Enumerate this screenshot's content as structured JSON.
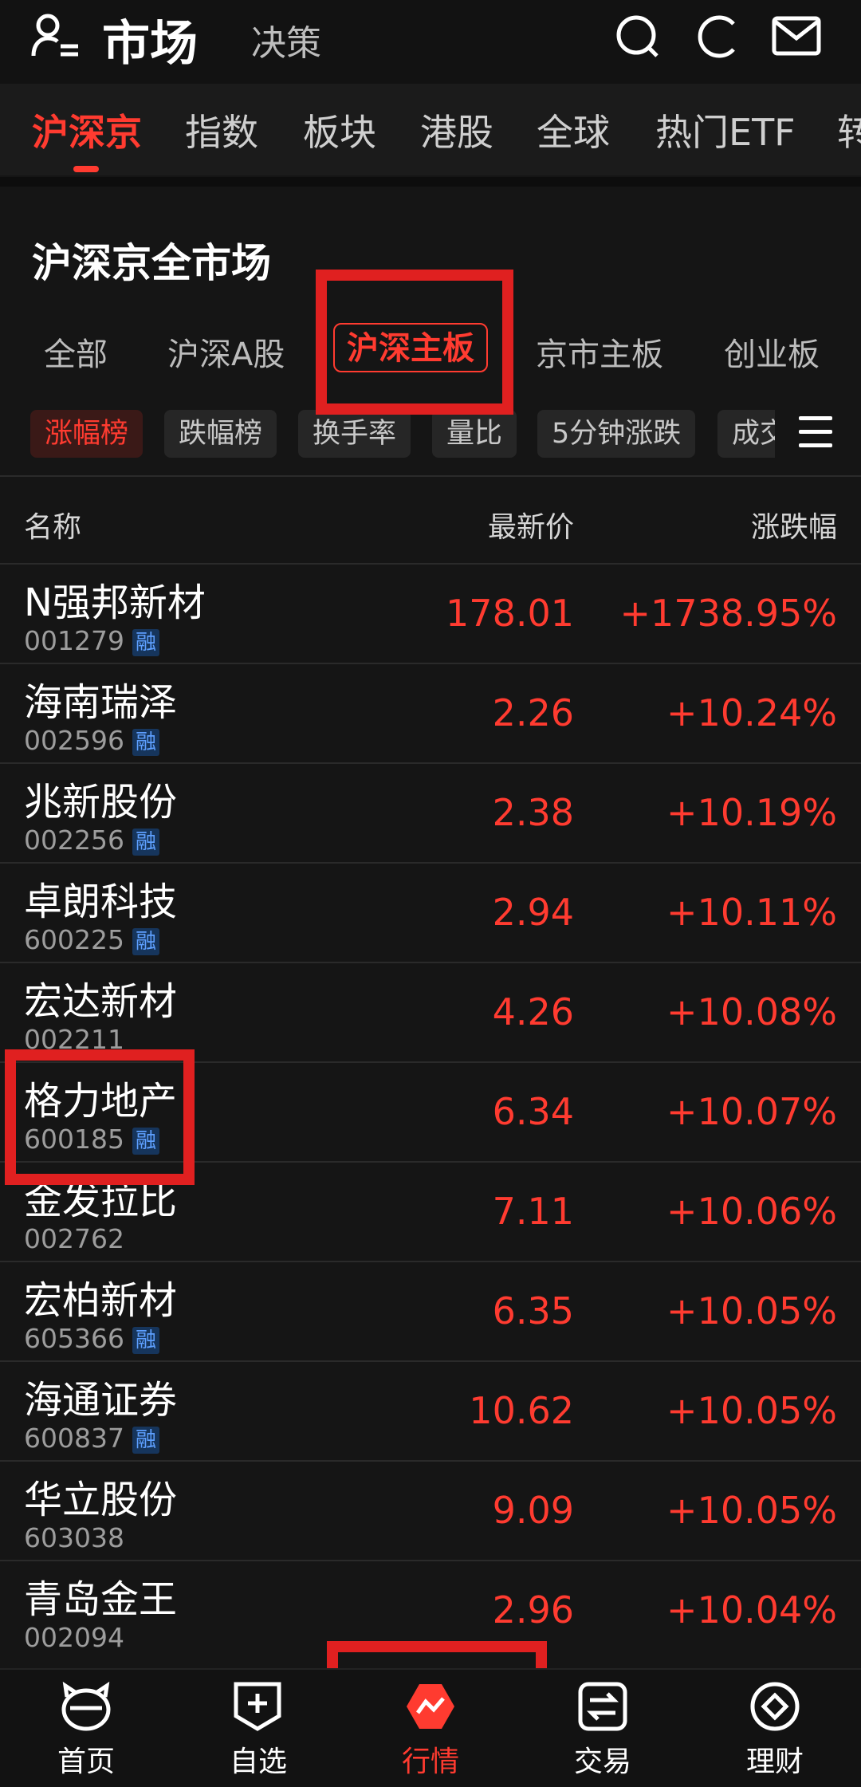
{
  "header": {
    "title": "市场",
    "subtitle": "决策"
  },
  "market_tabs": [
    "沪深京",
    "指数",
    "板块",
    "港股",
    "全球",
    "热门ETF",
    "转"
  ],
  "section_title": "沪深京全市场",
  "board_tabs": [
    "全部",
    "沪深A股",
    "沪深主板",
    "京市主板",
    "创业板"
  ],
  "chips": [
    "涨幅榜",
    "跌幅榜",
    "换手率",
    "量比",
    "5分钟涨跌",
    "成交"
  ],
  "columns": {
    "name": "名称",
    "price": "最新价",
    "change": "涨跌幅"
  },
  "rong_label": "融",
  "stocks": [
    {
      "name": "N强邦新材",
      "code": "001279",
      "price": "178.01",
      "change": "+1738.95%",
      "rong": true
    },
    {
      "name": "海南瑞泽",
      "code": "002596",
      "price": "2.26",
      "change": "+10.24%",
      "rong": true
    },
    {
      "name": "兆新股份",
      "code": "002256",
      "price": "2.38",
      "change": "+10.19%",
      "rong": true
    },
    {
      "name": "卓朗科技",
      "code": "600225",
      "price": "2.94",
      "change": "+10.11%",
      "rong": true
    },
    {
      "name": "宏达新材",
      "code": "002211",
      "price": "4.26",
      "change": "+10.08%",
      "rong": false
    },
    {
      "name": "格力地产",
      "code": "600185",
      "price": "6.34",
      "change": "+10.07%",
      "rong": true
    },
    {
      "name": "金发拉比",
      "code": "002762",
      "price": "7.11",
      "change": "+10.06%",
      "rong": false
    },
    {
      "name": "宏柏新材",
      "code": "605366",
      "price": "6.35",
      "change": "+10.05%",
      "rong": true
    },
    {
      "name": "海通证券",
      "code": "600837",
      "price": "10.62",
      "change": "+10.05%",
      "rong": true
    },
    {
      "name": "华立股份",
      "code": "603038",
      "price": "9.09",
      "change": "+10.05%",
      "rong": false
    },
    {
      "name": "青岛金王",
      "code": "002094",
      "price": "2.96",
      "change": "+10.04%",
      "rong": false
    }
  ],
  "bottom_nav": [
    "首页",
    "自选",
    "行情",
    "交易",
    "理财"
  ],
  "colors": {
    "accent": "#ff3b30",
    "background": "#151515",
    "annotation": "#e02020",
    "rong_badge": "#16355c"
  }
}
